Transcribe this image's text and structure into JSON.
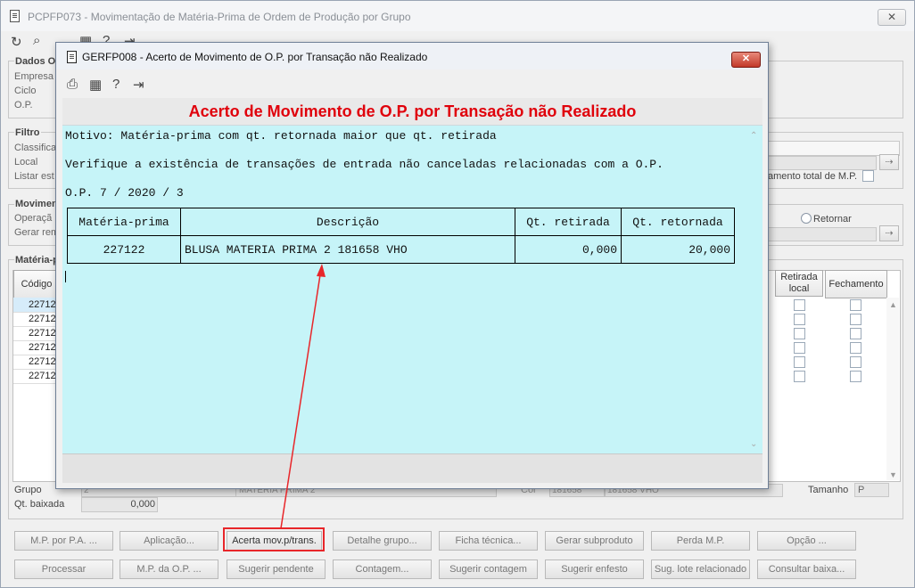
{
  "main": {
    "title": "PCPFP073 - Movimentação de Matéria-Prima de Ordem de Produção por Grupo",
    "close_label": "✕",
    "toolbar": [
      {
        "name": "refresh-icon",
        "glyph": "↻"
      },
      {
        "name": "search-icon",
        "glyph": "⌕"
      },
      {
        "name": "calendar-icon",
        "glyph": "▦"
      },
      {
        "name": "help-icon",
        "glyph": "?"
      },
      {
        "name": "exit-icon",
        "glyph": "⇥"
      }
    ],
    "dados": {
      "label": "Dados O",
      "fields": [
        "Empresa",
        "Ciclo",
        "O.P."
      ]
    },
    "filtro": {
      "label": "Filtro",
      "fields": [
        "Classifica",
        "Local",
        "Listar est"
      ],
      "check_label": "amento total de M.P."
    },
    "movimento": {
      "label": "Movimen",
      "fields": [
        "Operaçã",
        "Gerar rem"
      ],
      "radio_label": "Retornar"
    },
    "mp": {
      "label": "Matéria-p",
      "col_codigo": "Código",
      "col_retirada": "Retirada local",
      "col_fechamento": "Fechamento",
      "rows": [
        "22712",
        "22712",
        "22712",
        "22712",
        "22712",
        "22712"
      ]
    },
    "grupo": {
      "label": "Grupo",
      "value": "2",
      "desc": "MATERIA PRIMA 2"
    },
    "cor": {
      "label": "Cor",
      "value": "181658",
      "desc": "181658 VHO"
    },
    "tamanho": {
      "label": "Tamanho",
      "value": "P"
    },
    "qt_baixada": {
      "label": "Qt. baixada",
      "value": "0,000"
    },
    "buttons_row1": [
      "M.P. por P.A. ...",
      "Aplicação...",
      "Acerta mov.p/trans.",
      "Detalhe grupo...",
      "Ficha técnica...",
      "Gerar subproduto",
      "Perda M.P.",
      "Opção ..."
    ],
    "buttons_row2": [
      "Processar",
      "M.P. da O.P. ...",
      "Sugerir pendente",
      "Contagem...",
      "Sugerir contagem",
      "Sugerir enfesto",
      "Sug. lote relacionado",
      "Consultar baixa..."
    ]
  },
  "dialog": {
    "title": "GERFP008 - Acerto de Movimento de O.P. por Transação não Realizado",
    "close_label": "✕",
    "toolbar": [
      {
        "name": "print-icon",
        "glyph": "⎙"
      },
      {
        "name": "calendar-icon",
        "glyph": "▦"
      },
      {
        "name": "help-icon",
        "glyph": "?"
      },
      {
        "name": "exit-icon",
        "glyph": "⇥"
      }
    ],
    "heading": "Acerto de Movimento de O.P. por Transação não Realizado",
    "motivo": "Motivo: Matéria-prima com qt. retornada maior que qt. retirada",
    "verifique": "Verifique a existência de transações de entrada não canceladas relacionadas com a O.P.",
    "op": "O.P. 7 / 2020 / 3",
    "table": {
      "headers": [
        "Matéria-prima",
        "Descrição",
        "Qt. retirada",
        "Qt. retornada"
      ],
      "rows": [
        [
          "227122",
          "BLUSA MATERIA PRIMA 2 181658 VHO",
          "0,000",
          "20,000"
        ]
      ]
    }
  },
  "annotation": {
    "color": "#e8262a"
  }
}
